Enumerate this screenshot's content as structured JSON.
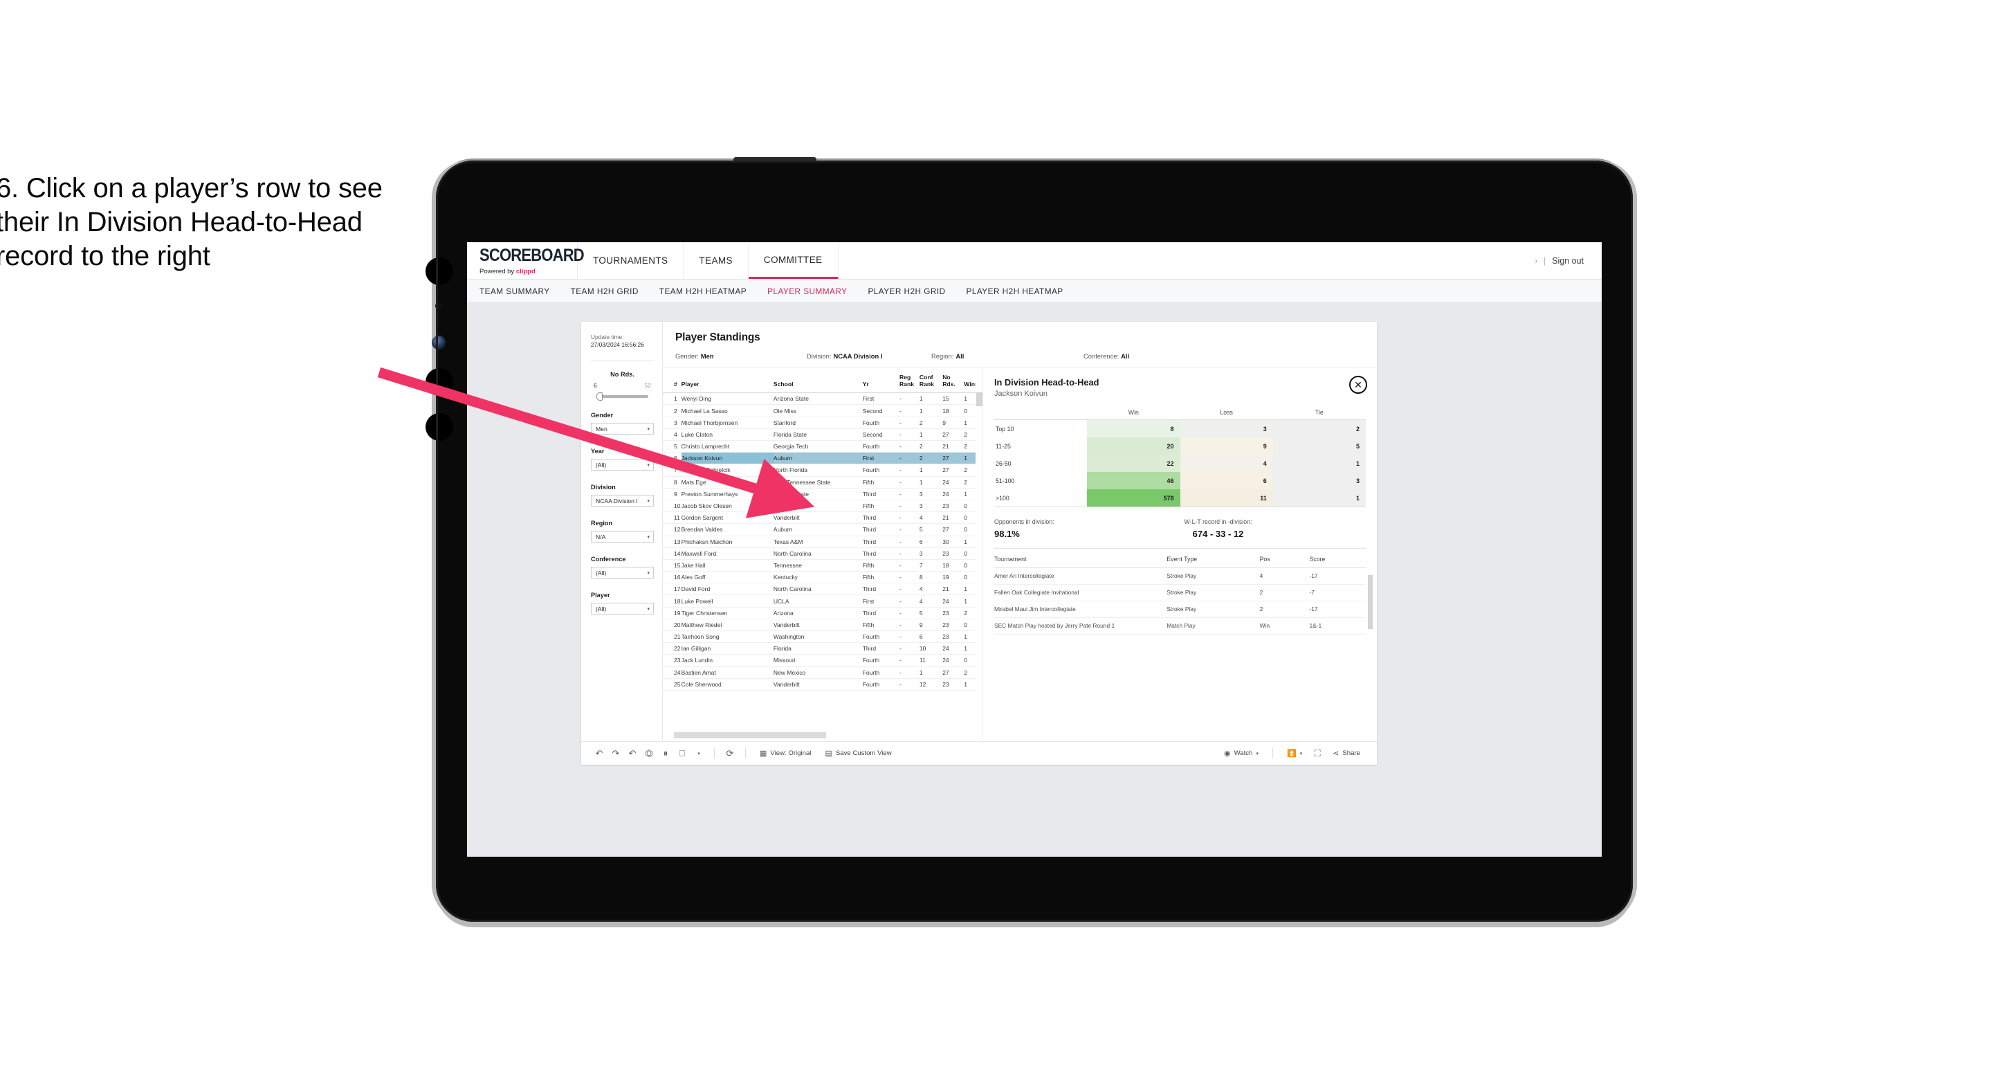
{
  "caption": "6. Click on a player’s row to see their In Division Head-to-Head record to the right",
  "appbar": {
    "brand_name": "SCOREBOARD",
    "brand_powered": "Powered by ",
    "brand_clippd": "clippd",
    "nav": [
      {
        "label": "TOURNAMENTS",
        "active": false
      },
      {
        "label": "TEAMS",
        "active": false
      },
      {
        "label": "COMMITTEE",
        "active": true
      }
    ],
    "account_chevron": "›",
    "separator": "|",
    "signout": "Sign out"
  },
  "subnav": [
    {
      "label": "TEAM SUMMARY",
      "active": false
    },
    {
      "label": "TEAM H2H GRID",
      "active": false
    },
    {
      "label": "TEAM H2H HEATMAP",
      "active": false
    },
    {
      "label": "PLAYER SUMMARY",
      "active": true
    },
    {
      "label": "PLAYER H2H GRID",
      "active": false
    },
    {
      "label": "PLAYER H2H HEATMAP",
      "active": false
    }
  ],
  "filters": {
    "update_label": "Update time:",
    "update_value": "27/03/2024 16:56:26",
    "slider": {
      "title": "No Rds.",
      "min": "6",
      "max": "52"
    },
    "groups": [
      {
        "title": "Gender",
        "value": "Men"
      },
      {
        "title": "Year",
        "value": "(All)"
      },
      {
        "title": "Division",
        "value": "NCAA Division I"
      },
      {
        "title": "Region",
        "value": "N/A"
      },
      {
        "title": "Conference",
        "value": "(All)"
      },
      {
        "title": "Player",
        "value": "(All)"
      }
    ],
    "caret": "▾"
  },
  "standings": {
    "title": "Player Standings",
    "meta": [
      {
        "label": "Gender:",
        "value": "Men"
      },
      {
        "label": "Division:",
        "value": "NCAA Division I"
      },
      {
        "label": "Region:",
        "value": "All"
      },
      {
        "label": "Conference:",
        "value": "All"
      }
    ],
    "columns": [
      "#",
      "Player",
      "School",
      "Yr",
      "Reg Rank",
      "Conf Rank",
      "No Rds.",
      "Wins"
    ],
    "rows": [
      {
        "num": "1",
        "player": "Wenyi Ding",
        "school": "Arizona State",
        "yr": "First",
        "reg": "-",
        "conf": "1",
        "rds": "15",
        "wins": "1",
        "selected": false
      },
      {
        "num": "2",
        "player": "Michael La Sasso",
        "school": "Ole Miss",
        "yr": "Second",
        "reg": "-",
        "conf": "1",
        "rds": "18",
        "wins": "0",
        "selected": false
      },
      {
        "num": "3",
        "player": "Michael Thorbjornsen",
        "school": "Stanford",
        "yr": "Fourth",
        "reg": "-",
        "conf": "2",
        "rds": "9",
        "wins": "1",
        "selected": false
      },
      {
        "num": "4",
        "player": "Luke Claton",
        "school": "Florida State",
        "yr": "Second",
        "reg": "-",
        "conf": "1",
        "rds": "27",
        "wins": "2",
        "selected": false
      },
      {
        "num": "5",
        "player": "Christo Lamprecht",
        "school": "Georgia Tech",
        "yr": "Fourth",
        "reg": "-",
        "conf": "2",
        "rds": "21",
        "wins": "2",
        "selected": false
      },
      {
        "num": "6",
        "player": "Jackson Koivun",
        "school": "Auburn",
        "yr": "First",
        "reg": "-",
        "conf": "2",
        "rds": "27",
        "wins": "1",
        "selected": true
      },
      {
        "num": "7",
        "player": "Nicholas Gabrelcik",
        "school": "North Florida",
        "yr": "Fourth",
        "reg": "-",
        "conf": "1",
        "rds": "27",
        "wins": "2",
        "selected": false
      },
      {
        "num": "8",
        "player": "Mats Ege",
        "school": "East Tennessee State",
        "yr": "Fifth",
        "reg": "-",
        "conf": "1",
        "rds": "24",
        "wins": "2",
        "selected": false
      },
      {
        "num": "9",
        "player": "Preston Summerhays",
        "school": "Arizona State",
        "yr": "Third",
        "reg": "-",
        "conf": "3",
        "rds": "24",
        "wins": "1",
        "selected": false
      },
      {
        "num": "10",
        "player": "Jacob Skov Olesen",
        "school": "Arkansas",
        "yr": "Fifth",
        "reg": "-",
        "conf": "3",
        "rds": "23",
        "wins": "0",
        "selected": false
      },
      {
        "num": "11",
        "player": "Gordon Sargent",
        "school": "Vanderbilt",
        "yr": "Third",
        "reg": "-",
        "conf": "4",
        "rds": "21",
        "wins": "0",
        "selected": false
      },
      {
        "num": "12",
        "player": "Brendan Valdes",
        "school": "Auburn",
        "yr": "Third",
        "reg": "-",
        "conf": "5",
        "rds": "27",
        "wins": "0",
        "selected": false
      },
      {
        "num": "13",
        "player": "Phichaksn Maichon",
        "school": "Texas A&M",
        "yr": "Third",
        "reg": "-",
        "conf": "6",
        "rds": "30",
        "wins": "1",
        "selected": false
      },
      {
        "num": "14",
        "player": "Maxwell Ford",
        "school": "North Carolina",
        "yr": "Third",
        "reg": "-",
        "conf": "3",
        "rds": "23",
        "wins": "0",
        "selected": false
      },
      {
        "num": "15",
        "player": "Jake Hall",
        "school": "Tennessee",
        "yr": "Fifth",
        "reg": "-",
        "conf": "7",
        "rds": "18",
        "wins": "0",
        "selected": false
      },
      {
        "num": "16",
        "player": "Alex Goff",
        "school": "Kentucky",
        "yr": "Fifth",
        "reg": "-",
        "conf": "8",
        "rds": "19",
        "wins": "0",
        "selected": false
      },
      {
        "num": "17",
        "player": "David Ford",
        "school": "North Carolina",
        "yr": "Third",
        "reg": "-",
        "conf": "4",
        "rds": "21",
        "wins": "1",
        "selected": false
      },
      {
        "num": "18",
        "player": "Luke Powell",
        "school": "UCLA",
        "yr": "First",
        "reg": "-",
        "conf": "4",
        "rds": "24",
        "wins": "1",
        "selected": false
      },
      {
        "num": "19",
        "player": "Tiger Christensen",
        "school": "Arizona",
        "yr": "Third",
        "reg": "-",
        "conf": "5",
        "rds": "23",
        "wins": "2",
        "selected": false
      },
      {
        "num": "20",
        "player": "Matthew Riedel",
        "school": "Vanderbilt",
        "yr": "Fifth",
        "reg": "-",
        "conf": "9",
        "rds": "23",
        "wins": "0",
        "selected": false
      },
      {
        "num": "21",
        "player": "Taehoon Song",
        "school": "Washington",
        "yr": "Fourth",
        "reg": "-",
        "conf": "6",
        "rds": "23",
        "wins": "1",
        "selected": false
      },
      {
        "num": "22",
        "player": "Ian Gilligan",
        "school": "Florida",
        "yr": "Third",
        "reg": "-",
        "conf": "10",
        "rds": "24",
        "wins": "1",
        "selected": false
      },
      {
        "num": "23",
        "player": "Jack Lundin",
        "school": "Missouri",
        "yr": "Fourth",
        "reg": "-",
        "conf": "11",
        "rds": "24",
        "wins": "0",
        "selected": false
      },
      {
        "num": "24",
        "player": "Bastien Amat",
        "school": "New Mexico",
        "yr": "Fourth",
        "reg": "-",
        "conf": "1",
        "rds": "27",
        "wins": "2",
        "selected": false
      },
      {
        "num": "25",
        "player": "Cole Sherwood",
        "school": "Vanderbilt",
        "yr": "Fourth",
        "reg": "-",
        "conf": "12",
        "rds": "23",
        "wins": "1",
        "selected": false
      }
    ]
  },
  "detail": {
    "title": "In Division Head-to-Head",
    "player": "Jackson Koivun",
    "close_icon": "✕",
    "matrix": {
      "columns": [
        "Win",
        "Loss",
        "Tie"
      ],
      "rows": [
        {
          "label": "Top 10",
          "win": "8",
          "loss": "3",
          "tie": "2",
          "win_color": "#e9f2e6",
          "loss_color": "#f0f0ee"
        },
        {
          "label": "11-25",
          "win": "20",
          "loss": "9",
          "tie": "5",
          "win_color": "#d9ebd2",
          "loss_color": "#f6f2e6"
        },
        {
          "label": "26-50",
          "win": "22",
          "loss": "4",
          "tie": "1",
          "win_color": "#dcecd5",
          "loss_color": "#f3f1ea"
        },
        {
          "label": "51-100",
          "win": "46",
          "loss": "6",
          "tie": "3",
          "win_color": "#afdca2",
          "loss_color": "#f6f1e4"
        },
        {
          "label": ">100",
          "win": "578",
          "loss": "11",
          "tie": "1",
          "win_color": "#79c96a",
          "loss_color": "#f5efe2"
        }
      ],
      "tie_color": "#efefef"
    },
    "summary": {
      "opponents_label": "Opponents in division:",
      "opponents_value": "98.1%",
      "record_label": "W-L-T record in -division:",
      "record_value": "674 - 33 - 12"
    },
    "tournaments": {
      "columns": [
        "Tournament",
        "Event Type",
        "Pos",
        "Score"
      ],
      "rows": [
        {
          "name": "Amer Ari Intercollegiate",
          "type": "Stroke Play",
          "pos": "4",
          "score": "-17"
        },
        {
          "name": "Fallen Oak Collegiate Invitational",
          "type": "Stroke Play",
          "pos": "2",
          "score": "-7"
        },
        {
          "name": "Mirabel Maui Jim Intercollegiate",
          "type": "Stroke Play",
          "pos": "2",
          "score": "-17"
        },
        {
          "name": "SEC Match Play hosted by Jerry Pate Round 1",
          "type": "Match Play",
          "pos": "Win",
          "score": "1&-1"
        }
      ]
    }
  },
  "toolbar": {
    "icons": [
      "undo-icon",
      "redo-icon",
      "revert-icon",
      "refresh-icon",
      "pause-icon",
      "highlight-icon"
    ],
    "caret": "▾",
    "clock_icon": "⟳",
    "view_label": "View: Original",
    "save_label": "Save Custom View",
    "watch_label": "Watch",
    "share_label": "Share"
  },
  "colors": {
    "accent_pink": "#d6285a",
    "arrow_pink": "#ef3465",
    "selection_blue": "#9dc6d8",
    "screen_bg": "#e7e9ec"
  }
}
